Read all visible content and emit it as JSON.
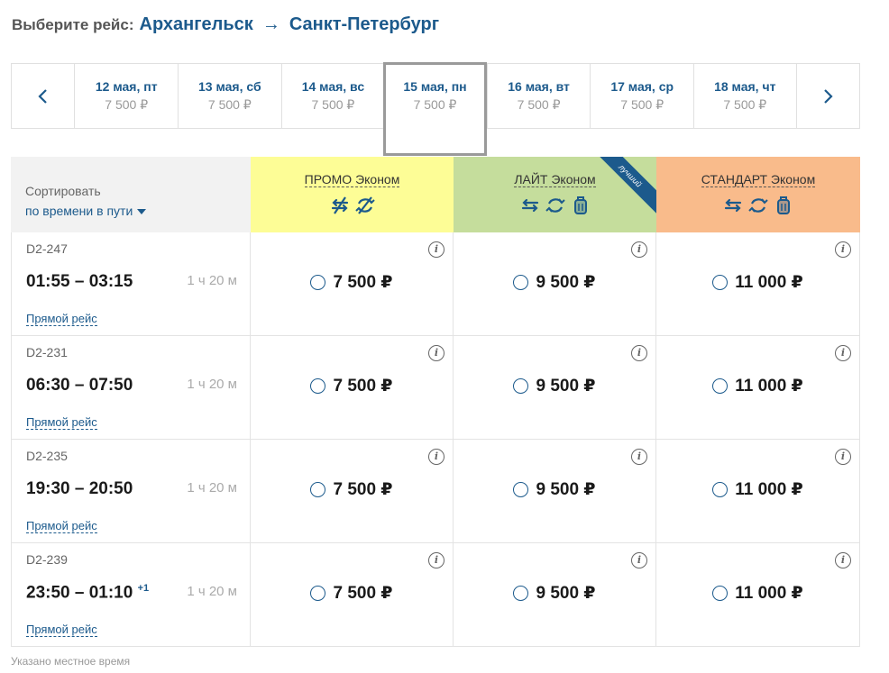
{
  "header": {
    "label": "Выберите рейс:",
    "from": "Архангельск",
    "arrow": "→",
    "to": "Санкт-Петербург"
  },
  "dates": [
    {
      "date": "12 мая, пт",
      "price": "7 500 ₽",
      "selected": false
    },
    {
      "date": "13 мая, сб",
      "price": "7 500 ₽",
      "selected": false
    },
    {
      "date": "14 мая, вс",
      "price": "7 500 ₽",
      "selected": false
    },
    {
      "date": "15 мая, пн",
      "price": "7 500 ₽",
      "selected": true
    },
    {
      "date": "16 мая, вт",
      "price": "7 500 ₽",
      "selected": false
    },
    {
      "date": "17 мая, ср",
      "price": "7 500 ₽",
      "selected": false
    },
    {
      "date": "18 мая, чт",
      "price": "7 500 ₽",
      "selected": false
    }
  ],
  "nav_icons": {
    "prev": "chevron-left-icon",
    "next": "chevron-right-icon"
  },
  "sort": {
    "label": "Сортировать",
    "value": "по времени в пути"
  },
  "fares": [
    {
      "name": "ПРОМО Эконом",
      "color": "#fdfd96",
      "icons": [
        "no-exchange-icon",
        "no-refund-icon"
      ]
    },
    {
      "name": "ЛАЙТ Эконом",
      "color": "#c5dd9c",
      "ribbon": "лучший",
      "icons": [
        "exchange-icon",
        "refund-icon",
        "baggage-icon"
      ]
    },
    {
      "name": "СТАНДАРТ Эконом",
      "color": "#f9bb8b",
      "icons": [
        "exchange-icon",
        "refund-icon",
        "baggage-icon"
      ]
    }
  ],
  "colors": {
    "accent": "#1c5a8c",
    "selected_border": "#9a9a9a"
  },
  "flights": [
    {
      "number": "D2-247",
      "time": "01:55 – 03:15",
      "next_day": "",
      "duration": "1 ч 20 м",
      "direct": "Прямой рейс",
      "prices": [
        "7 500 ₽",
        "9 500 ₽",
        "11 000 ₽"
      ]
    },
    {
      "number": "D2-231",
      "time": "06:30 – 07:50",
      "next_day": "",
      "duration": "1 ч 20 м",
      "direct": "Прямой рейс",
      "prices": [
        "7 500 ₽",
        "9 500 ₽",
        "11 000 ₽"
      ]
    },
    {
      "number": "D2-235",
      "time": "19:30 – 20:50",
      "next_day": "",
      "duration": "1 ч 20 м",
      "direct": "Прямой рейс",
      "prices": [
        "7 500 ₽",
        "9 500 ₽",
        "11 000 ₽"
      ]
    },
    {
      "number": "D2-239",
      "time": "23:50 – 01:10",
      "next_day": "+1",
      "duration": "1 ч 20 м",
      "direct": "Прямой рейс",
      "prices": [
        "7 500 ₽",
        "9 500 ₽",
        "11 000 ₽"
      ]
    }
  ],
  "footnote": "Указано местное время"
}
